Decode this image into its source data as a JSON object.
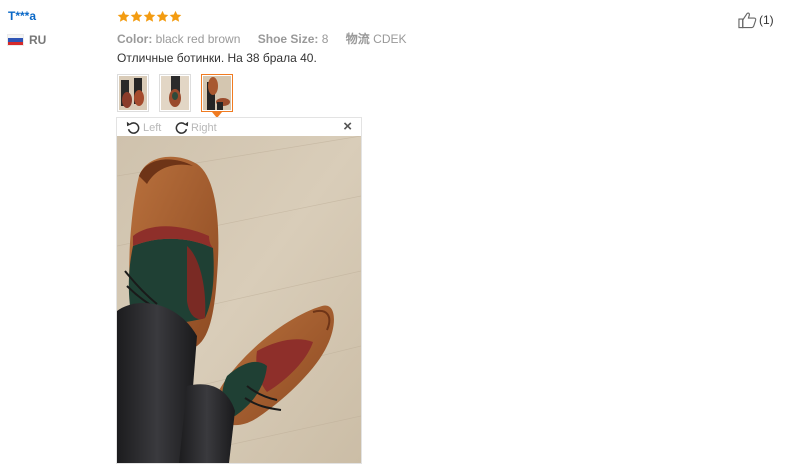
{
  "reviewer": {
    "name": "T***a",
    "country_code": "RU",
    "flag_icon": "russia-flag-icon"
  },
  "review": {
    "rating": 5,
    "rating_max": 5,
    "star_color": "#f39c12",
    "color_label": "Color:",
    "color_value": "black red brown",
    "size_label": "Shoe Size:",
    "size_value": "8",
    "logistics_label": "物流",
    "logistics_value": "CDEK",
    "text": "Отличные ботинки. На 38 брала 40."
  },
  "thumbnails": [
    {
      "name": "review-thumbnail-1",
      "active": false
    },
    {
      "name": "review-thumbnail-2",
      "active": false
    },
    {
      "name": "review-thumbnail-3",
      "active": true
    }
  ],
  "viewer": {
    "rotate_left_label": "Left",
    "rotate_right_label": "Right",
    "close_label": "×",
    "image_description_icon": "shoe-photo"
  },
  "helpful": {
    "icon": "thumbs-up-icon",
    "count": "(1)"
  },
  "colors": {
    "link_blue": "#0a68c7",
    "accent_orange": "#f07b21",
    "muted_gray": "#999999"
  }
}
